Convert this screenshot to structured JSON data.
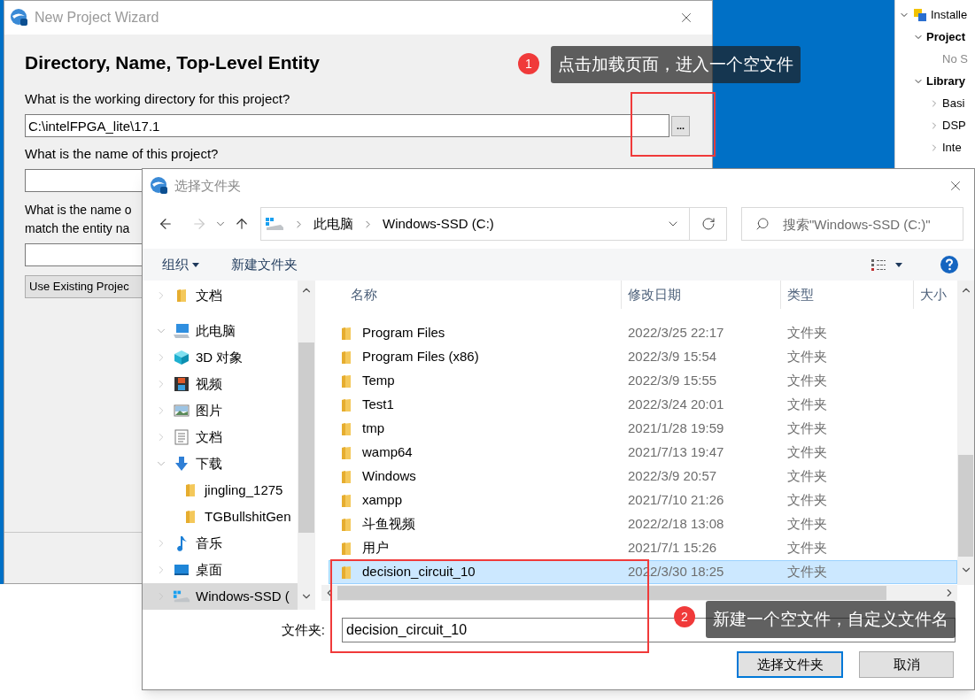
{
  "wizard": {
    "title": "New Project Wizard",
    "heading": "Directory, Name, Top-Level Entity",
    "directory_label": "What is the working directory for this project?",
    "directory_value": "C:\\intelFPGA_lite\\17.1",
    "browse_button": "...",
    "name_label": "What is the name of this project?",
    "entity_label": [
      "What is the name o",
      "match the entity na"
    ],
    "existing_button": "Use Existing Projec"
  },
  "library_panel": {
    "tree": [
      {
        "label": "Installe",
        "expanded": true,
        "children": [
          {
            "label": "Project",
            "expanded": true,
            "children": [
              {
                "label": "No S"
              }
            ]
          },
          {
            "label": "Library",
            "expanded": true,
            "children": [
              {
                "label": "Basi",
                "expanded": false
              },
              {
                "label": "DSP",
                "expanded": false
              },
              {
                "label": "Inte",
                "expanded": false
              }
            ]
          }
        ]
      }
    ]
  },
  "dialog": {
    "title": "选择文件夹",
    "path": [
      "此电脑",
      "Windows-SSD (C:)"
    ],
    "search_placeholder": "搜索\"Windows-SSD (C:)\"",
    "toolbar": {
      "organize": "组织",
      "new_folder": "新建文件夹"
    },
    "sidebar": [
      {
        "label": "文档",
        "kind": "folder",
        "expanded": false,
        "selected": false
      },
      {
        "label": "此电脑",
        "kind": "computer",
        "expanded": true,
        "selected": false,
        "children": [
          {
            "label": "3D 对象",
            "kind": "cube",
            "expanded": false,
            "selected": false
          },
          {
            "label": "视频",
            "kind": "video",
            "expanded": false,
            "selected": false
          },
          {
            "label": "图片",
            "kind": "picture",
            "expanded": false,
            "selected": false
          },
          {
            "label": "文档",
            "kind": "document",
            "expanded": false,
            "selected": false
          },
          {
            "label": "下载",
            "kind": "download",
            "expanded": true,
            "selected": false,
            "children": [
              {
                "label": "jingling_1275",
                "kind": "folder",
                "selected": false
              },
              {
                "label": "TGBullshitGen",
                "kind": "folder",
                "selected": false
              }
            ]
          },
          {
            "label": "音乐",
            "kind": "music",
            "expanded": false,
            "selected": false
          },
          {
            "label": "桌面",
            "kind": "desktop",
            "expanded": false,
            "selected": false
          },
          {
            "label": "Windows-SSD (",
            "kind": "drive",
            "expanded": false,
            "selected": true
          }
        ]
      }
    ],
    "columns": [
      "名称",
      "修改日期",
      "类型",
      "大小"
    ],
    "rows": [
      {
        "name": "Program Files",
        "date": "2022/3/25 22:17",
        "type": "文件夹",
        "selected": false
      },
      {
        "name": "Program Files (x86)",
        "date": "2022/3/9 15:54",
        "type": "文件夹",
        "selected": false
      },
      {
        "name": "Temp",
        "date": "2022/3/9 15:55",
        "type": "文件夹",
        "selected": false
      },
      {
        "name": "Test1",
        "date": "2022/3/24 20:01",
        "type": "文件夹",
        "selected": false
      },
      {
        "name": "tmp",
        "date": "2021/1/28 19:59",
        "type": "文件夹",
        "selected": false
      },
      {
        "name": "wamp64",
        "date": "2021/7/13 19:47",
        "type": "文件夹",
        "selected": false
      },
      {
        "name": "Windows",
        "date": "2022/3/9 20:57",
        "type": "文件夹",
        "selected": false
      },
      {
        "name": "xampp",
        "date": "2021/7/10 21:26",
        "type": "文件夹",
        "selected": false
      },
      {
        "name": "斗鱼视频",
        "date": "2022/2/18 13:08",
        "type": "文件夹",
        "selected": false
      },
      {
        "name": "用户",
        "date": "2021/7/1 15:26",
        "type": "文件夹",
        "selected": false
      },
      {
        "name": "decision_circuit_10",
        "date": "2022/3/30 18:25",
        "type": "文件夹",
        "selected": true
      }
    ],
    "folder_label": "文件夹:",
    "folder_value": "decision_circuit_10",
    "buttons": [
      {
        "label": "选择文件夹",
        "default": true
      },
      {
        "label": "取消",
        "default": false
      }
    ]
  },
  "annotations": [
    {
      "number": "1",
      "text": "点击加载页面，进入一个空文件"
    },
    {
      "number": "2",
      "text": "新建一个空文件，自定义文件名"
    }
  ]
}
